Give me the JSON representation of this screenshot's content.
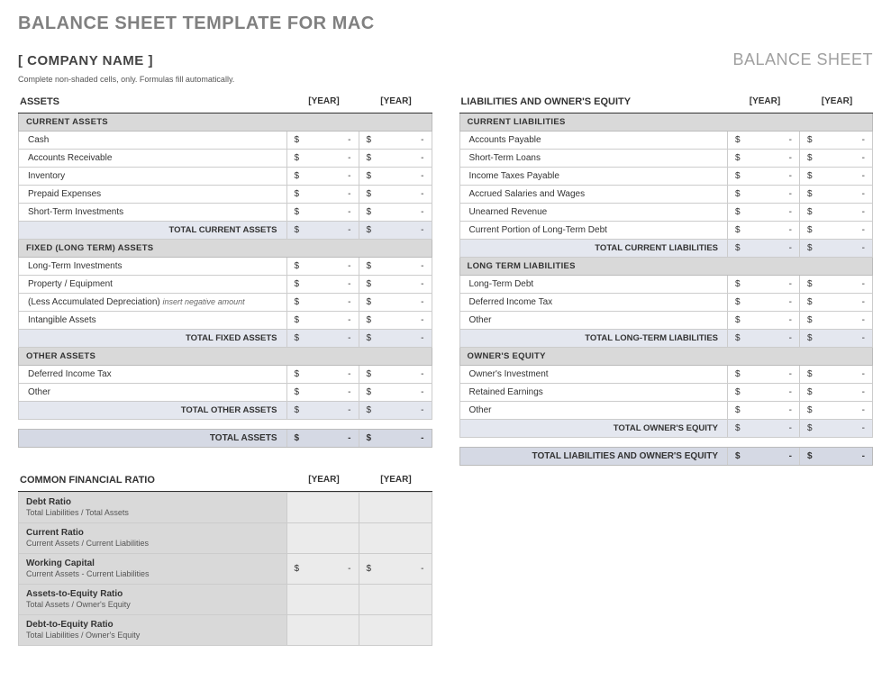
{
  "page_title": "BALANCE SHEET TEMPLATE FOR MAC",
  "company_name": "[ COMPANY NAME ]",
  "doc_type": "BALANCE SHEET",
  "instruction": "Complete non-shaded cells, only.  Formulas fill automatically.",
  "year1": "[YEAR]",
  "year2": "[YEAR]",
  "currency": "$",
  "empty": "-",
  "assets": {
    "title": "ASSETS",
    "current": {
      "title": "CURRENT ASSETS",
      "rows": [
        "Cash",
        "Accounts Receivable",
        "Inventory",
        "Prepaid Expenses",
        "Short-Term Investments"
      ],
      "total": "TOTAL CURRENT ASSETS"
    },
    "fixed": {
      "title": "FIXED (LONG TERM) ASSETS",
      "rows": [
        {
          "label": "Long-Term Investments",
          "note": ""
        },
        {
          "label": "Property / Equipment",
          "note": ""
        },
        {
          "label": "(Less Accumulated Depreciation)",
          "note": "insert negative amount"
        },
        {
          "label": "Intangible Assets",
          "note": ""
        }
      ],
      "total": "TOTAL FIXED ASSETS"
    },
    "other": {
      "title": "OTHER ASSETS",
      "rows": [
        "Deferred Income Tax",
        "Other"
      ],
      "total": "TOTAL OTHER ASSETS"
    },
    "grand_total": "TOTAL ASSETS"
  },
  "liab": {
    "title": "LIABILITIES AND OWNER'S EQUITY",
    "current": {
      "title": "CURRENT LIABILITIES",
      "rows": [
        "Accounts Payable",
        "Short-Term Loans",
        "Income Taxes Payable",
        "Accrued Salaries and Wages",
        "Unearned Revenue",
        "Current Portion of Long-Term Debt"
      ],
      "total": "TOTAL CURRENT LIABILITIES"
    },
    "longterm": {
      "title": "LONG TERM LIABILITIES",
      "rows": [
        "Long-Term Debt",
        "Deferred Income Tax",
        "Other"
      ],
      "total": "TOTAL LONG-TERM LIABILITIES"
    },
    "equity": {
      "title": "OWNER'S EQUITY",
      "rows": [
        "Owner's Investment",
        "Retained Earnings",
        "Other"
      ],
      "total": "TOTAL OWNER'S EQUITY"
    },
    "grand_total": "TOTAL LIABILITIES AND OWNER'S EQUITY"
  },
  "ratios": {
    "title": "COMMON FINANCIAL RATIO",
    "items": [
      {
        "name": "Debt Ratio",
        "desc": "Total Liabilities / Total Assets",
        "money": false
      },
      {
        "name": "Current Ratio",
        "desc": "Current Assets / Current Liabilities",
        "money": false
      },
      {
        "name": "Working Capital",
        "desc": "Current Assets - Current Liabilities",
        "money": true
      },
      {
        "name": "Assets-to-Equity Ratio",
        "desc": "Total Assets / Owner's Equity",
        "money": false
      },
      {
        "name": "Debt-to-Equity Ratio",
        "desc": "Total Liabilities / Owner's Equity",
        "money": false
      }
    ]
  }
}
